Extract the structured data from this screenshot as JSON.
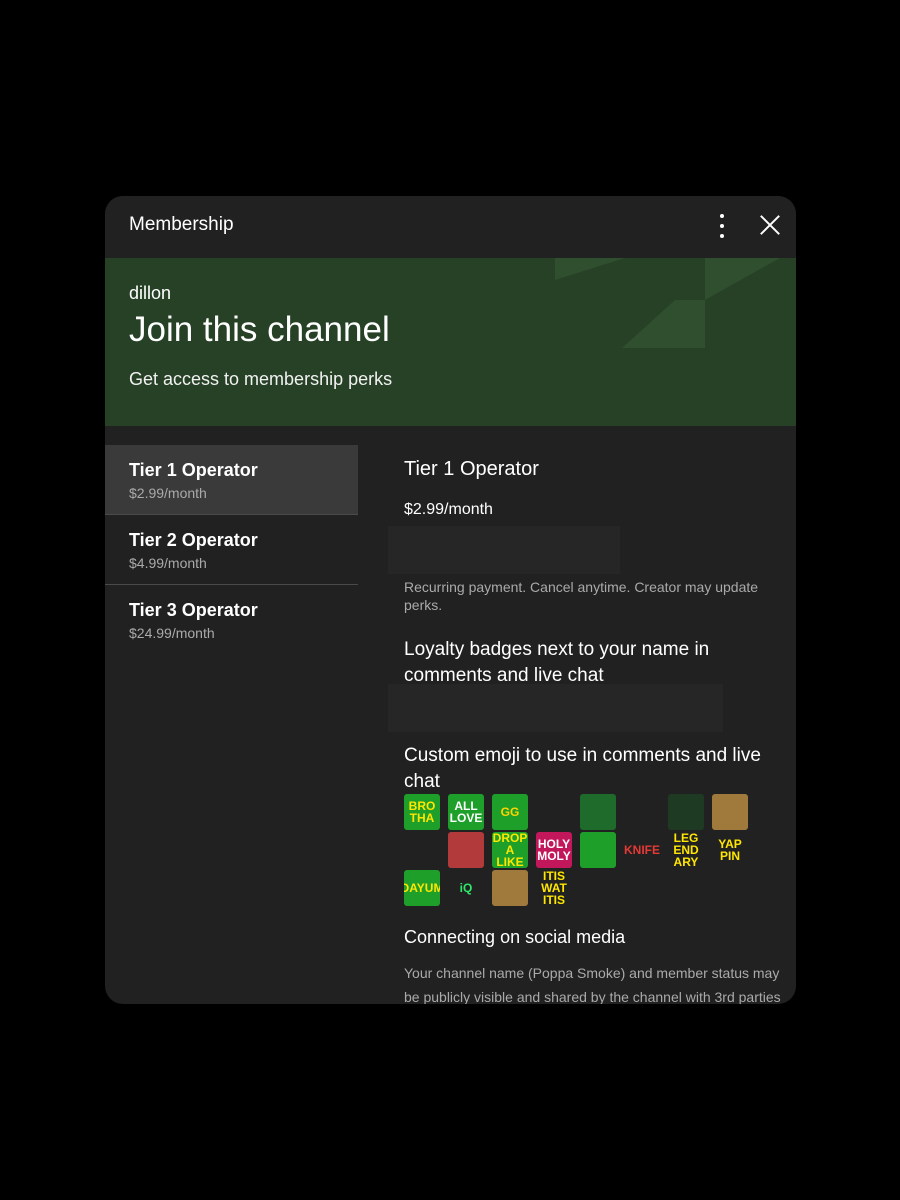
{
  "dialog": {
    "title": "Membership",
    "more_icon": "more-vert-icon",
    "close_icon": "close-icon"
  },
  "banner": {
    "channel": "dillon",
    "title": "Join this channel",
    "subtitle": "Get access to membership perks",
    "color": "#264126"
  },
  "tiers": [
    {
      "name": "Tier 1 Operator",
      "price": "$2.99/month",
      "selected": true
    },
    {
      "name": "Tier 2 Operator",
      "price": "$4.99/month",
      "selected": false
    },
    {
      "name": "Tier 3 Operator",
      "price": "$24.99/month",
      "selected": false
    }
  ],
  "detail": {
    "tier_name": "Tier 1 Operator",
    "price": "$2.99/month",
    "note": "Recurring payment. Cancel anytime. Creator may update perks.",
    "loyalty": "Loyalty badges next to your name in comments and live chat",
    "emoji_heading": "Custom emoji to use in comments and live chat",
    "emojis": [
      {
        "text": "BRO THA",
        "bg": "#1d9f2a",
        "fg": "#ffe600"
      },
      {
        "text": "ALL LOVE",
        "bg": "#1d9f2a",
        "fg": "#ffffff"
      },
      {
        "text": "GG",
        "bg": "#1d9f2a",
        "fg": "#ffd400"
      },
      {
        "text": "",
        "bg": "#212121",
        "fg": "#d9a441"
      },
      {
        "text": "",
        "bg": "#1e6b2c",
        "fg": "#cfcfcf"
      },
      {
        "text": "",
        "bg": "#212121",
        "fg": "#d4a30c"
      },
      {
        "text": "",
        "bg": "#1f3a22",
        "fg": "#9e9e9e"
      },
      {
        "text": "",
        "bg": "#a07a3c",
        "fg": "#ffffff"
      },
      {
        "text": "",
        "bg": "#212121",
        "fg": "#e8a23a"
      },
      {
        "text": "",
        "bg": "#b33a3a",
        "fg": "#ffffff"
      },
      {
        "text": "DROP A LIKE",
        "bg": "#1d9f2a",
        "fg": "#ffe600"
      },
      {
        "text": "HOLY MOLY",
        "bg": "#c2185b",
        "fg": "#ffffff"
      },
      {
        "text": "",
        "bg": "#1d9f2a",
        "fg": "#ffffff"
      },
      {
        "text": "[KNIFE]",
        "bg": "#212121",
        "fg": "#e53935"
      },
      {
        "text": "LEG END ARY",
        "bg": "#212121",
        "fg": "#ffe600"
      },
      {
        "text": "YAP PIN",
        "bg": "#212121",
        "fg": "#ffe600"
      },
      {
        "text": "DAYUM",
        "bg": "#1d9f2a",
        "fg": "#ffe600"
      },
      {
        "text": "iQ",
        "bg": "#212121",
        "fg": "#2ee86a"
      },
      {
        "text": "",
        "bg": "#a07a3c",
        "fg": "#ffffff"
      },
      {
        "text": "ITIS WAT ITIS",
        "bg": "#212121",
        "fg": "#ffe600"
      }
    ],
    "social_heading": "Connecting on social media",
    "social_text": "Your channel name (Poppa Smoke) and member status may be publicly visible and shared by the channel with 3rd parties"
  }
}
